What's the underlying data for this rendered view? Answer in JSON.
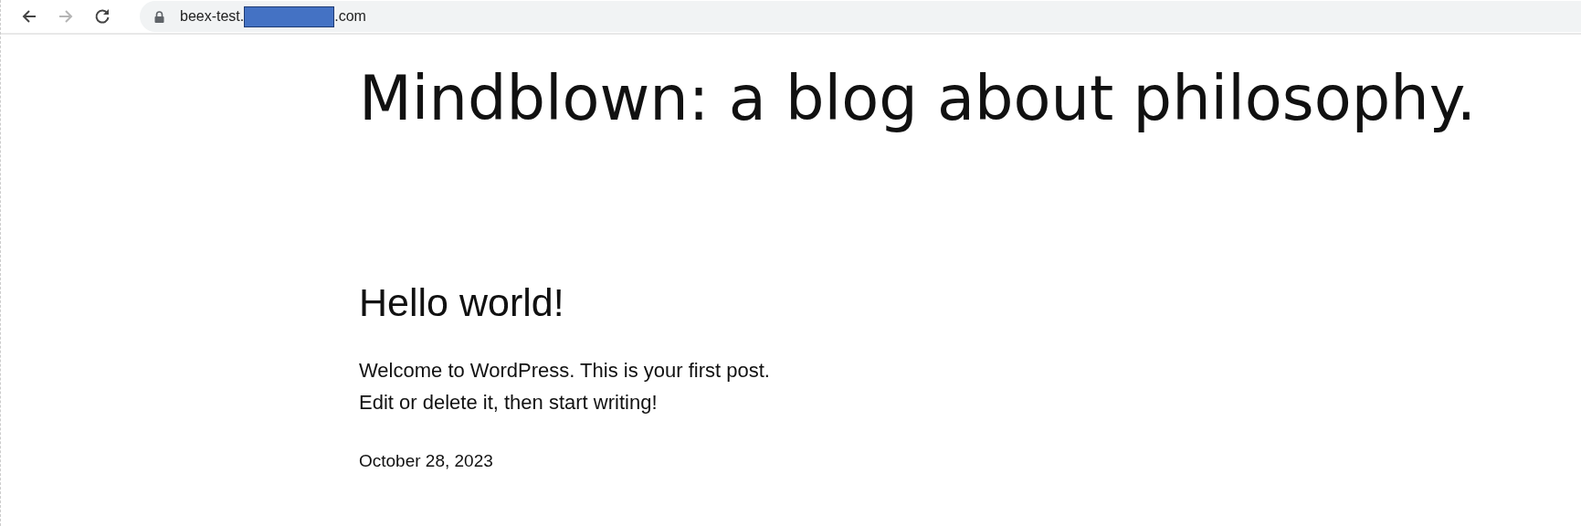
{
  "browser": {
    "nav_buttons": [
      {
        "kind": "back",
        "disabled": false
      },
      {
        "kind": "forward",
        "disabled": true
      },
      {
        "kind": "reload",
        "disabled": false
      }
    ],
    "address": {
      "prefix": "beex-test.",
      "suffix": ".com",
      "redacted": true
    }
  },
  "site": {
    "title": "Mindblown: a blog about philosophy."
  },
  "post": {
    "title": "Hello world!",
    "lines": [
      "Welcome to WordPress. This is your first post.",
      "Edit or delete it, then start writing!"
    ],
    "date": "October 28, 2023"
  }
}
